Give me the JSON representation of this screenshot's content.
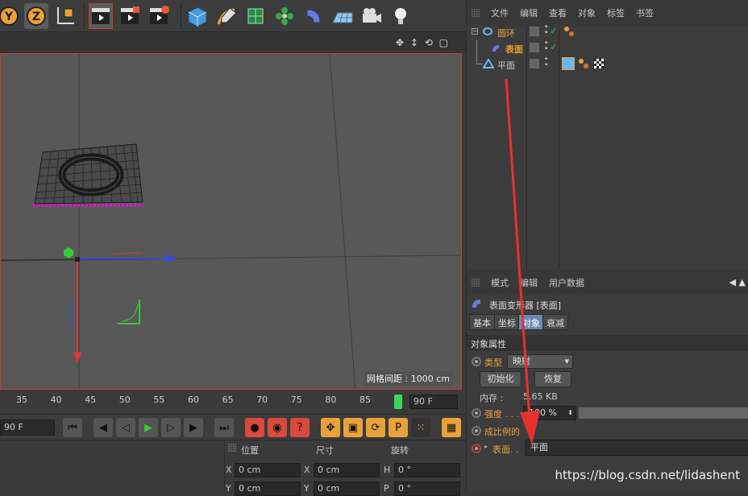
{
  "toolbar": {
    "axis_y": "Y",
    "axis_z": "Z"
  },
  "viewport": {
    "grid_spacing": "网格间距 : 1000 cm"
  },
  "timeline": {
    "ticks": [
      "35",
      "40",
      "45",
      "50",
      "55",
      "60",
      "65",
      "70",
      "75",
      "80",
      "85"
    ],
    "end_frame": "90 F"
  },
  "playbar": {
    "frame_field": "90 F"
  },
  "coord": {
    "header_position": "位置",
    "header_size": "尺寸",
    "header_rotation": "旋转",
    "x_label": "X",
    "x_pos": "0 cm",
    "x_size_label": "X",
    "x_size": "0 cm",
    "h_label": "H",
    "h_val": "0 °",
    "y_label": "Y",
    "y_pos": "0 cm",
    "y_size_label": "Y",
    "y_size": "0 cm",
    "p_label": "P",
    "p_val": "0 °"
  },
  "object_manager": {
    "menu": [
      "文件",
      "编辑",
      "查看",
      "对象",
      "标签",
      "书签"
    ],
    "objects": [
      {
        "name": "圆环",
        "color": "#e8a23a"
      },
      {
        "name": "表面",
        "color": "#f0a030"
      },
      {
        "name": "平面",
        "color": "#c8c8c8"
      }
    ]
  },
  "attributes": {
    "menu": [
      "模式",
      "编辑",
      "用户数据"
    ],
    "object_title": "表面变形器 [表面]",
    "tabs": [
      "基本",
      "坐标",
      "对象",
      "衰减"
    ],
    "section_title": "对象属性",
    "type_label": "类型",
    "type_value": "映射",
    "init_button": "初始化",
    "restore_button": "恢复",
    "memory_label": "内存 :",
    "memory_value": "5.65 KB",
    "strength_label": "强度 . . . . .",
    "strength_value": "100 %",
    "strength_fraction": 1.0,
    "proportional_label": "成比例的",
    "surface_label": "表面. .",
    "surface_value": "平面"
  },
  "watermark": "https://blog.csdn.net/lidashent",
  "colors": {
    "accent": "#e8a23a",
    "selection_red": "#c83a3a",
    "arrow_red": "#e83030"
  }
}
